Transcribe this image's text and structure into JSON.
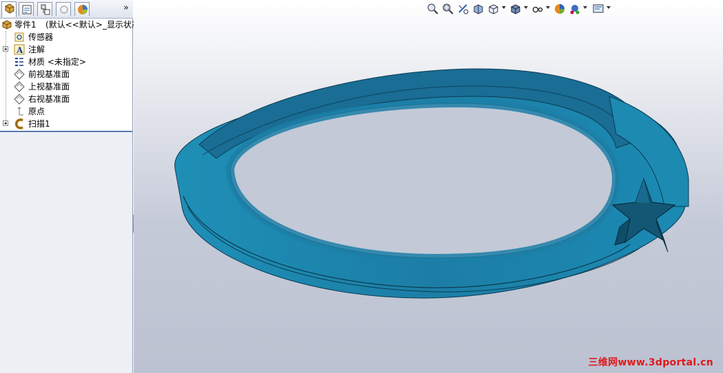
{
  "panel": {
    "expand_glyph": "»",
    "tabs": [
      {
        "name": "feature-manager-icon"
      },
      {
        "name": "property-manager-icon"
      },
      {
        "name": "configuration-manager-icon"
      },
      {
        "name": "dim-xpert-icon"
      },
      {
        "name": "display-manager-icon"
      }
    ]
  },
  "tree": {
    "root_label": "零件1",
    "root_state": "(默认<<默认>_显示状态",
    "items": [
      {
        "label": "传感器",
        "icon": "sensor-icon"
      },
      {
        "label": "注解",
        "icon": "annotation-icon",
        "expandable": true
      },
      {
        "label": "材质 <未指定>",
        "icon": "material-icon"
      },
      {
        "label": "前视基准面",
        "icon": "plane-icon"
      },
      {
        "label": "上视基准面",
        "icon": "plane-icon"
      },
      {
        "label": "右视基准面",
        "icon": "plane-icon"
      },
      {
        "label": "原点",
        "icon": "origin-icon"
      },
      {
        "label": "扫描1",
        "icon": "sweep-icon",
        "expandable": true
      }
    ]
  },
  "toolbar": {
    "items": [
      "zoom-to-fit-icon",
      "zoom-to-area-icon",
      "previous-view-icon",
      "section-view-icon",
      "view-orientation-icon",
      "display-style-icon",
      "hide-show-items-icon",
      "edit-appearance-icon",
      "apply-scene-icon",
      "view-settings-icon"
    ]
  },
  "colors": {
    "model_fill": "#1c7aa0",
    "model_dark": "#0f4f6c",
    "watermark": "#e0181a"
  },
  "watermark": "三维网www.3dportal.cn"
}
